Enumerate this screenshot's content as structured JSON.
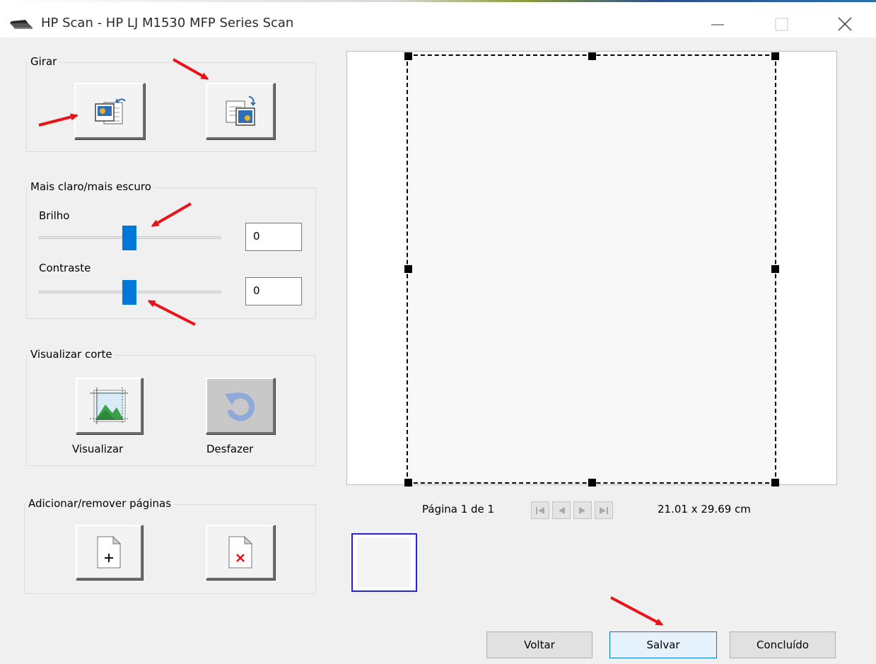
{
  "window": {
    "title": "HP Scan - HP LJ M1530 MFP Series Scan",
    "icons": {
      "app": "scanner-icon",
      "minimize": "minimize-icon",
      "maximize": "maximize-icon",
      "close": "close-icon"
    }
  },
  "rotate_group": {
    "label": "Girar",
    "buttons": [
      {
        "name": "rotate-left",
        "icon": "rotate-left-icon"
      },
      {
        "name": "rotate-right",
        "icon": "rotate-right-icon"
      }
    ]
  },
  "brightness_group": {
    "label": "Mais claro/mais escuro",
    "brightness": {
      "label": "Brilho",
      "value": "0"
    },
    "contrast": {
      "label": "Contraste",
      "value": "0"
    }
  },
  "crop_group": {
    "label": "Visualizar corte",
    "preview_button": {
      "label": "Visualizar",
      "icon": "crop-preview-icon"
    },
    "undo_button": {
      "label": "Desfazer",
      "icon": "undo-icon"
    }
  },
  "pages_group": {
    "label": "Adicionar/remover páginas",
    "add_icon": "add-page-icon",
    "remove_icon": "remove-page-icon"
  },
  "pager": {
    "page_label": "Página 1 de 1",
    "dimensions": "21.01 x 29.69 cm",
    "nav_icons": [
      "first-page-icon",
      "prev-page-icon",
      "next-page-icon",
      "last-page-icon"
    ]
  },
  "footer": {
    "back_label": "Voltar",
    "save_label": "Salvar",
    "done_label": "Concluído"
  },
  "colors": {
    "accent": "#0078d7",
    "annotation_arrow": "#e8141a",
    "thumbnail_border": "#2525d0"
  }
}
